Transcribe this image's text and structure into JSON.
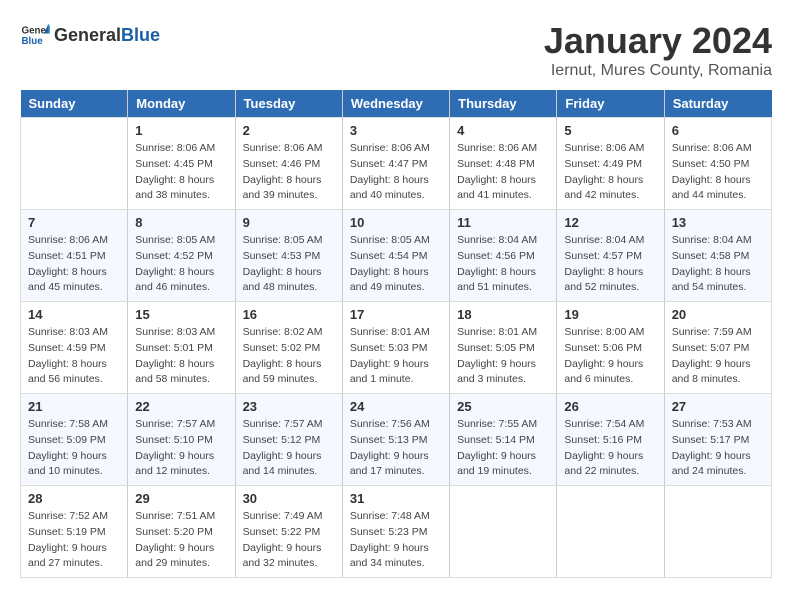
{
  "header": {
    "logo_general": "General",
    "logo_blue": "Blue",
    "month": "January 2024",
    "location": "Iernut, Mures County, Romania"
  },
  "days_of_week": [
    "Sunday",
    "Monday",
    "Tuesday",
    "Wednesday",
    "Thursday",
    "Friday",
    "Saturday"
  ],
  "weeks": [
    [
      {
        "day": "",
        "info": ""
      },
      {
        "day": "1",
        "info": "Sunrise: 8:06 AM\nSunset: 4:45 PM\nDaylight: 8 hours\nand 38 minutes."
      },
      {
        "day": "2",
        "info": "Sunrise: 8:06 AM\nSunset: 4:46 PM\nDaylight: 8 hours\nand 39 minutes."
      },
      {
        "day": "3",
        "info": "Sunrise: 8:06 AM\nSunset: 4:47 PM\nDaylight: 8 hours\nand 40 minutes."
      },
      {
        "day": "4",
        "info": "Sunrise: 8:06 AM\nSunset: 4:48 PM\nDaylight: 8 hours\nand 41 minutes."
      },
      {
        "day": "5",
        "info": "Sunrise: 8:06 AM\nSunset: 4:49 PM\nDaylight: 8 hours\nand 42 minutes."
      },
      {
        "day": "6",
        "info": "Sunrise: 8:06 AM\nSunset: 4:50 PM\nDaylight: 8 hours\nand 44 minutes."
      }
    ],
    [
      {
        "day": "7",
        "info": "Sunrise: 8:06 AM\nSunset: 4:51 PM\nDaylight: 8 hours\nand 45 minutes."
      },
      {
        "day": "8",
        "info": "Sunrise: 8:05 AM\nSunset: 4:52 PM\nDaylight: 8 hours\nand 46 minutes."
      },
      {
        "day": "9",
        "info": "Sunrise: 8:05 AM\nSunset: 4:53 PM\nDaylight: 8 hours\nand 48 minutes."
      },
      {
        "day": "10",
        "info": "Sunrise: 8:05 AM\nSunset: 4:54 PM\nDaylight: 8 hours\nand 49 minutes."
      },
      {
        "day": "11",
        "info": "Sunrise: 8:04 AM\nSunset: 4:56 PM\nDaylight: 8 hours\nand 51 minutes."
      },
      {
        "day": "12",
        "info": "Sunrise: 8:04 AM\nSunset: 4:57 PM\nDaylight: 8 hours\nand 52 minutes."
      },
      {
        "day": "13",
        "info": "Sunrise: 8:04 AM\nSunset: 4:58 PM\nDaylight: 8 hours\nand 54 minutes."
      }
    ],
    [
      {
        "day": "14",
        "info": "Sunrise: 8:03 AM\nSunset: 4:59 PM\nDaylight: 8 hours\nand 56 minutes."
      },
      {
        "day": "15",
        "info": "Sunrise: 8:03 AM\nSunset: 5:01 PM\nDaylight: 8 hours\nand 58 minutes."
      },
      {
        "day": "16",
        "info": "Sunrise: 8:02 AM\nSunset: 5:02 PM\nDaylight: 8 hours\nand 59 minutes."
      },
      {
        "day": "17",
        "info": "Sunrise: 8:01 AM\nSunset: 5:03 PM\nDaylight: 9 hours\nand 1 minute."
      },
      {
        "day": "18",
        "info": "Sunrise: 8:01 AM\nSunset: 5:05 PM\nDaylight: 9 hours\nand 3 minutes."
      },
      {
        "day": "19",
        "info": "Sunrise: 8:00 AM\nSunset: 5:06 PM\nDaylight: 9 hours\nand 6 minutes."
      },
      {
        "day": "20",
        "info": "Sunrise: 7:59 AM\nSunset: 5:07 PM\nDaylight: 9 hours\nand 8 minutes."
      }
    ],
    [
      {
        "day": "21",
        "info": "Sunrise: 7:58 AM\nSunset: 5:09 PM\nDaylight: 9 hours\nand 10 minutes."
      },
      {
        "day": "22",
        "info": "Sunrise: 7:57 AM\nSunset: 5:10 PM\nDaylight: 9 hours\nand 12 minutes."
      },
      {
        "day": "23",
        "info": "Sunrise: 7:57 AM\nSunset: 5:12 PM\nDaylight: 9 hours\nand 14 minutes."
      },
      {
        "day": "24",
        "info": "Sunrise: 7:56 AM\nSunset: 5:13 PM\nDaylight: 9 hours\nand 17 minutes."
      },
      {
        "day": "25",
        "info": "Sunrise: 7:55 AM\nSunset: 5:14 PM\nDaylight: 9 hours\nand 19 minutes."
      },
      {
        "day": "26",
        "info": "Sunrise: 7:54 AM\nSunset: 5:16 PM\nDaylight: 9 hours\nand 22 minutes."
      },
      {
        "day": "27",
        "info": "Sunrise: 7:53 AM\nSunset: 5:17 PM\nDaylight: 9 hours\nand 24 minutes."
      }
    ],
    [
      {
        "day": "28",
        "info": "Sunrise: 7:52 AM\nSunset: 5:19 PM\nDaylight: 9 hours\nand 27 minutes."
      },
      {
        "day": "29",
        "info": "Sunrise: 7:51 AM\nSunset: 5:20 PM\nDaylight: 9 hours\nand 29 minutes."
      },
      {
        "day": "30",
        "info": "Sunrise: 7:49 AM\nSunset: 5:22 PM\nDaylight: 9 hours\nand 32 minutes."
      },
      {
        "day": "31",
        "info": "Sunrise: 7:48 AM\nSunset: 5:23 PM\nDaylight: 9 hours\nand 34 minutes."
      },
      {
        "day": "",
        "info": ""
      },
      {
        "day": "",
        "info": ""
      },
      {
        "day": "",
        "info": ""
      }
    ]
  ]
}
